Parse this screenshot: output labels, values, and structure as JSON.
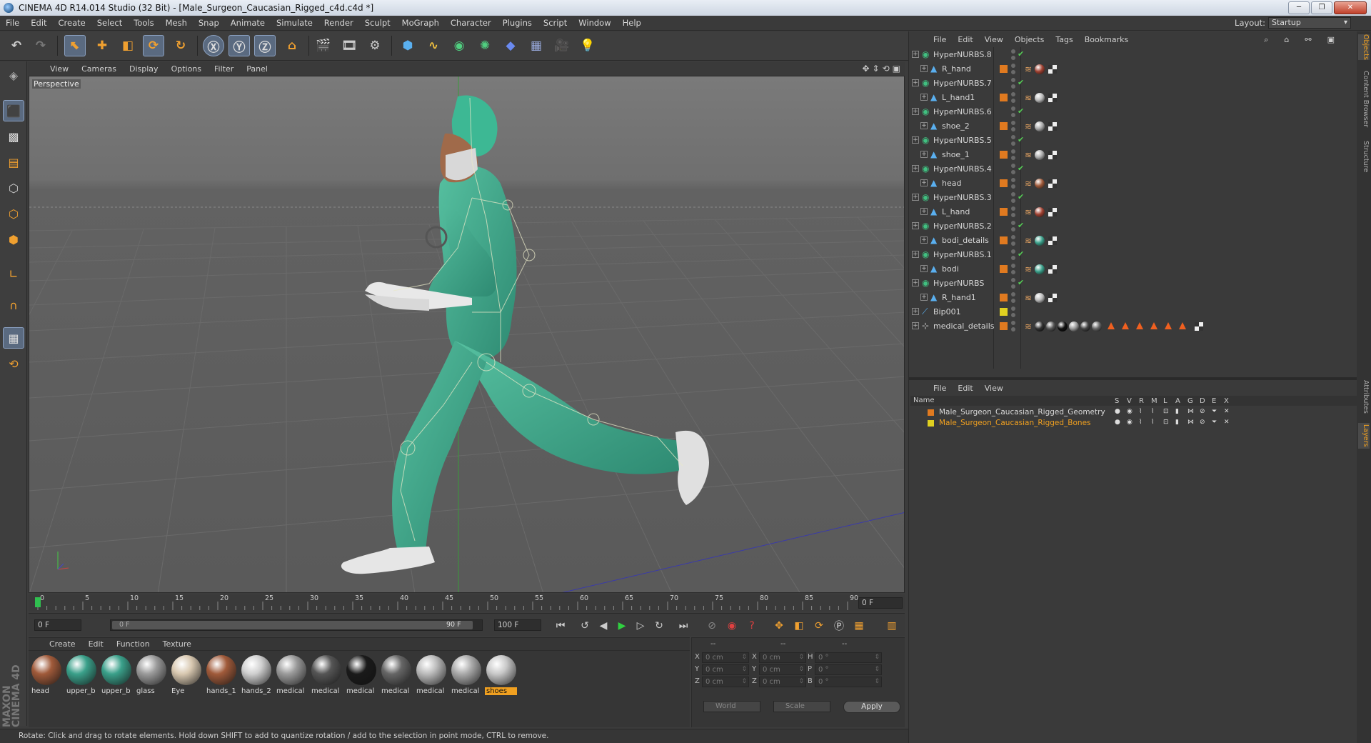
{
  "window": {
    "title": "CINEMA 4D R14.014 Studio (32 Bit) - [Male_Surgeon_Caucasian_Rigged_c4d.c4d *]",
    "buttons": [
      "─",
      "❐",
      "✕"
    ]
  },
  "menubar": {
    "items": [
      "File",
      "Edit",
      "Create",
      "Select",
      "Tools",
      "Mesh",
      "Snap",
      "Animate",
      "Simulate",
      "Render",
      "Sculpt",
      "MoGraph",
      "Character",
      "Plugins",
      "Script",
      "Window",
      "Help"
    ],
    "layout_label": "Layout:",
    "layout_value": "Startup"
  },
  "viewport": {
    "menu": [
      "View",
      "Cameras",
      "Display",
      "Options",
      "Filter",
      "Panel"
    ],
    "label": "Perspective"
  },
  "timeline": {
    "ticks": [
      "0",
      "5",
      "10",
      "15",
      "20",
      "25",
      "30",
      "35",
      "40",
      "45",
      "50",
      "55",
      "60",
      "65",
      "70",
      "75",
      "80",
      "85",
      "90"
    ],
    "current_frame": "0 F"
  },
  "playback": {
    "start": "0 F",
    "range_start": "0 F",
    "range_end": "90 F",
    "end": "100 F"
  },
  "materials": {
    "menu": [
      "Create",
      "Edit",
      "Function",
      "Texture"
    ],
    "items": [
      {
        "label": "head",
        "color": "#a05a3a",
        "selected": false
      },
      {
        "label": "upper_b",
        "color": "#3aa08a",
        "selected": false
      },
      {
        "label": "upper_b",
        "color": "#3aa08a",
        "selected": false
      },
      {
        "label": "glass",
        "color": "#9a9a9a",
        "selected": false
      },
      {
        "label": "Eye",
        "color": "#d8c8b0",
        "selected": false
      },
      {
        "label": "hands_1",
        "color": "#a05a3a",
        "selected": false
      },
      {
        "label": "hands_2",
        "color": "#cfcfcf",
        "selected": false
      },
      {
        "label": "medical",
        "color": "#9a9a9a",
        "selected": false
      },
      {
        "label": "medical",
        "color": "#555555",
        "selected": false
      },
      {
        "label": "medical",
        "color": "#1a1a1a",
        "selected": false
      },
      {
        "label": "medical",
        "color": "#666666",
        "selected": false
      },
      {
        "label": "medical",
        "color": "#bbbbbb",
        "selected": false
      },
      {
        "label": "medical",
        "color": "#aaaaaa",
        "selected": false
      },
      {
        "label": "shoes",
        "color": "#c8c8c8",
        "selected": true
      }
    ]
  },
  "coords": {
    "headers": [
      "--",
      "--",
      "--"
    ],
    "rows": [
      {
        "a": "X",
        "av": "0 cm",
        "b": "X",
        "bv": "0 cm",
        "c": "H",
        "cv": "0 °"
      },
      {
        "a": "Y",
        "av": "0 cm",
        "b": "Y",
        "bv": "0 cm",
        "c": "P",
        "cv": "0 °"
      },
      {
        "a": "Z",
        "av": "0 cm",
        "b": "Z",
        "bv": "0 cm",
        "c": "B",
        "cv": "0 °"
      }
    ],
    "mode1": "World",
    "mode2": "Scale",
    "apply": "Apply"
  },
  "status": "Rotate: Click and drag to rotate elements. Hold down SHIFT to add to quantize rotation / add to the selection in point mode, CTRL to remove.",
  "objects": {
    "menu": [
      "File",
      "Edit",
      "View",
      "Objects",
      "Tags",
      "Bookmarks"
    ],
    "rows": [
      {
        "name": "HyperNURBS.8",
        "kind": "nurbs",
        "indent": 0
      },
      {
        "name": "R_hand",
        "kind": "mesh",
        "indent": 1,
        "tag": "#a04030"
      },
      {
        "name": "HyperNURBS.7",
        "kind": "nurbs",
        "indent": 0
      },
      {
        "name": "L_hand1",
        "kind": "mesh",
        "indent": 1,
        "tag": "#bbbbbb"
      },
      {
        "name": "HyperNURBS.6",
        "kind": "nurbs",
        "indent": 0
      },
      {
        "name": "shoe_2",
        "kind": "mesh",
        "indent": 1,
        "tag": "#aaaaaa"
      },
      {
        "name": "HyperNURBS.5",
        "kind": "nurbs",
        "indent": 0
      },
      {
        "name": "shoe_1",
        "kind": "mesh",
        "indent": 1,
        "tag": "#aaaaaa"
      },
      {
        "name": "HyperNURBS.4",
        "kind": "nurbs",
        "indent": 0
      },
      {
        "name": "head",
        "kind": "mesh",
        "indent": 1,
        "tag": "#a05a3a"
      },
      {
        "name": "HyperNURBS.3",
        "kind": "nurbs",
        "indent": 0
      },
      {
        "name": "L_hand",
        "kind": "mesh",
        "indent": 1,
        "tag": "#a04030"
      },
      {
        "name": "HyperNURBS.2",
        "kind": "nurbs",
        "indent": 0
      },
      {
        "name": "bodi_details",
        "kind": "mesh",
        "indent": 1,
        "tag": "#3aa08a"
      },
      {
        "name": "HyperNURBS.1",
        "kind": "nurbs",
        "indent": 0
      },
      {
        "name": "bodi",
        "kind": "mesh",
        "indent": 1,
        "tag": "#3aa08a"
      },
      {
        "name": "HyperNURBS",
        "kind": "nurbs",
        "indent": 0
      },
      {
        "name": "R_hand1",
        "kind": "mesh",
        "indent": 1,
        "tag": "#bbbbbb"
      },
      {
        "name": "Bip001",
        "kind": "bone",
        "indent": 0,
        "layer": "#e0d020"
      },
      {
        "name": "medical_details",
        "kind": "null",
        "indent": 0,
        "tags": [
          "#333333",
          "#555555",
          "#111111",
          "#999999",
          "#444444",
          "#666666"
        ],
        "tris": 6
      }
    ]
  },
  "layers": {
    "menu": [
      "File",
      "Edit",
      "View"
    ],
    "header": {
      "name": "Name",
      "cols": [
        "S",
        "V",
        "R",
        "M",
        "L",
        "A",
        "G",
        "D",
        "E",
        "X"
      ]
    },
    "rows": [
      {
        "name": "Male_Surgeon_Caucasian_Rigged_Geometry",
        "color": "#e07a20",
        "textcolor": "#d8d8d8"
      },
      {
        "name": "Male_Surgeon_Caucasian_Rigged_Bones",
        "color": "#e0d020",
        "textcolor": "#f0a020"
      }
    ]
  },
  "side_tabs": {
    "top": [
      "Objects",
      "Content Browser",
      "Structure"
    ],
    "bottom": [
      "Attributes",
      "Layers"
    ]
  }
}
